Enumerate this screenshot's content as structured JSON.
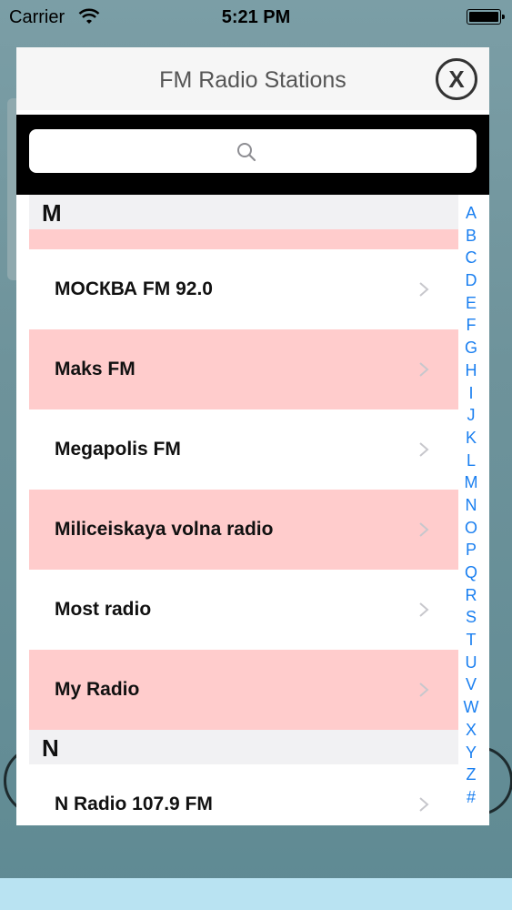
{
  "status_bar": {
    "carrier": "Carrier",
    "time": "5:21 PM"
  },
  "modal": {
    "title": "FM Radio Stations",
    "close_label": "X",
    "search_icon": "search-icon"
  },
  "sections": [
    {
      "letter": "M",
      "stations": [
        "МОСКВА FM 92.0",
        "Maks FM",
        "Megapolis FM",
        "Miliceiskaya volna radio",
        "Most radio",
        "My Radio"
      ]
    },
    {
      "letter": "N",
      "stations": [
        "N Radio 107.9 FM"
      ]
    }
  ],
  "index_letters": [
    "A",
    "B",
    "C",
    "D",
    "E",
    "F",
    "G",
    "H",
    "I",
    "J",
    "K",
    "L",
    "M",
    "N",
    "O",
    "P",
    "Q",
    "R",
    "S",
    "T",
    "U",
    "V",
    "W",
    "X",
    "Y",
    "Z",
    "#"
  ],
  "colors": {
    "row_highlight": "#ffcccc",
    "index_text": "#1a7ff0",
    "section_bg": "#f1f1f3"
  }
}
